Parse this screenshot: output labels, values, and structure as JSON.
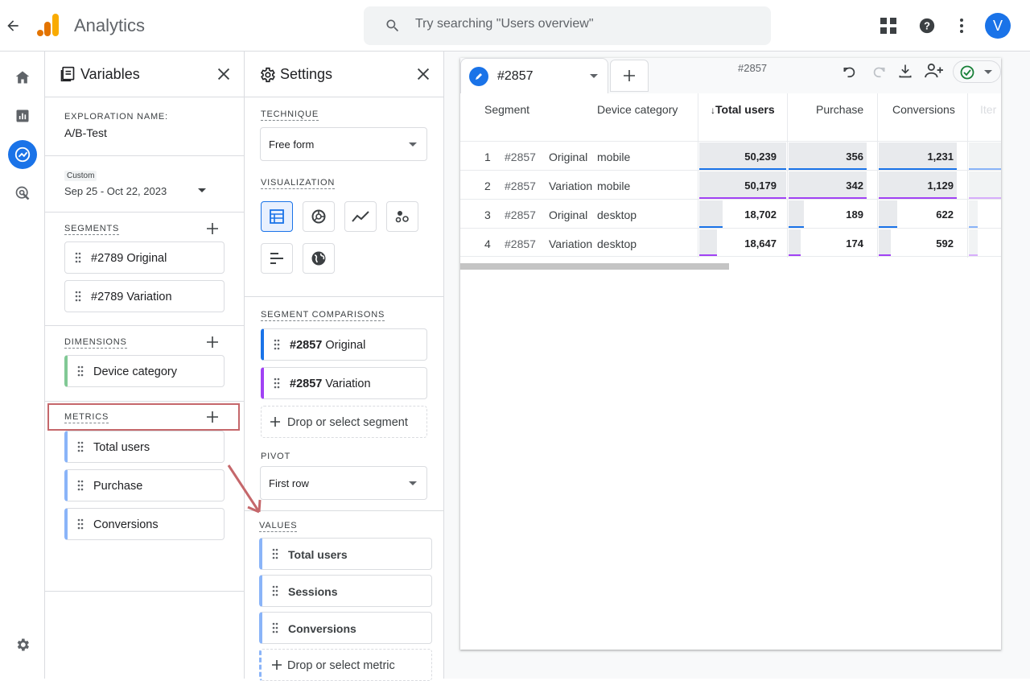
{
  "app": {
    "title": "Analytics",
    "avatar_letter": "V"
  },
  "search": {
    "placeholder": "Try searching \"Users overview\""
  },
  "variables": {
    "title": "Variables",
    "exploration_label": "EXPLORATION NAME:",
    "exploration_name": "A/B-Test",
    "date_badge": "Custom",
    "date_range": "Sep 25 - Oct 22, 2023",
    "segments_label": "SEGMENTS",
    "segments": [
      "#2789 Original",
      "#2789 Variation"
    ],
    "dimensions_label": "DIMENSIONS",
    "dimensions": [
      "Device category"
    ],
    "metrics_label": "METRICS",
    "metrics": [
      "Total users",
      "Purchase",
      "Conversions"
    ]
  },
  "settings": {
    "title": "Settings",
    "technique_label": "TECHNIQUE",
    "technique_value": "Free form",
    "visualization_label": "VISUALIZATION",
    "segment_comparisons_label": "SEGMENT COMPARISONS",
    "segment_comparisons": [
      {
        "id": "#2857",
        "name": "Original",
        "color": "#1a73e8"
      },
      {
        "id": "#2857",
        "name": "Variation",
        "color": "#a142f4"
      }
    ],
    "drop_segment": "Drop or select segment",
    "pivot_label": "PIVOT",
    "pivot_value": "First row",
    "values_label": "VALUES",
    "values": [
      "Total users",
      "Sessions",
      "Conversions"
    ],
    "drop_metric": "Drop or select metric"
  },
  "tab": {
    "name": "#2857",
    "center_title": "#2857"
  },
  "table": {
    "headers": {
      "segment": "Segment",
      "device": "Device category",
      "total_users": "Total users",
      "purchase": "Purchase",
      "conversions": "Conversions",
      "items": "Iter"
    },
    "sort_arrow": "↓",
    "rows": [
      {
        "n": "1",
        "seg_id": "#2857",
        "seg_name": "Original",
        "device": "mobile",
        "total_users": "50,239",
        "purchase": "356",
        "conversions": "1,231"
      },
      {
        "n": "2",
        "seg_id": "#2857",
        "seg_name": "Variation",
        "device": "mobile",
        "total_users": "50,179",
        "purchase": "342",
        "conversions": "1,129"
      },
      {
        "n": "3",
        "seg_id": "#2857",
        "seg_name": "Original",
        "device": "desktop",
        "total_users": "18,702",
        "purchase": "189",
        "conversions": "622"
      },
      {
        "n": "4",
        "seg_id": "#2857",
        "seg_name": "Variation",
        "device": "desktop",
        "total_users": "18,647",
        "purchase": "174",
        "conversions": "592"
      }
    ]
  },
  "colors": {
    "accent": "#1a73e8",
    "variation": "#a142f4",
    "highlight": "#c5676b",
    "check": "#188038"
  }
}
